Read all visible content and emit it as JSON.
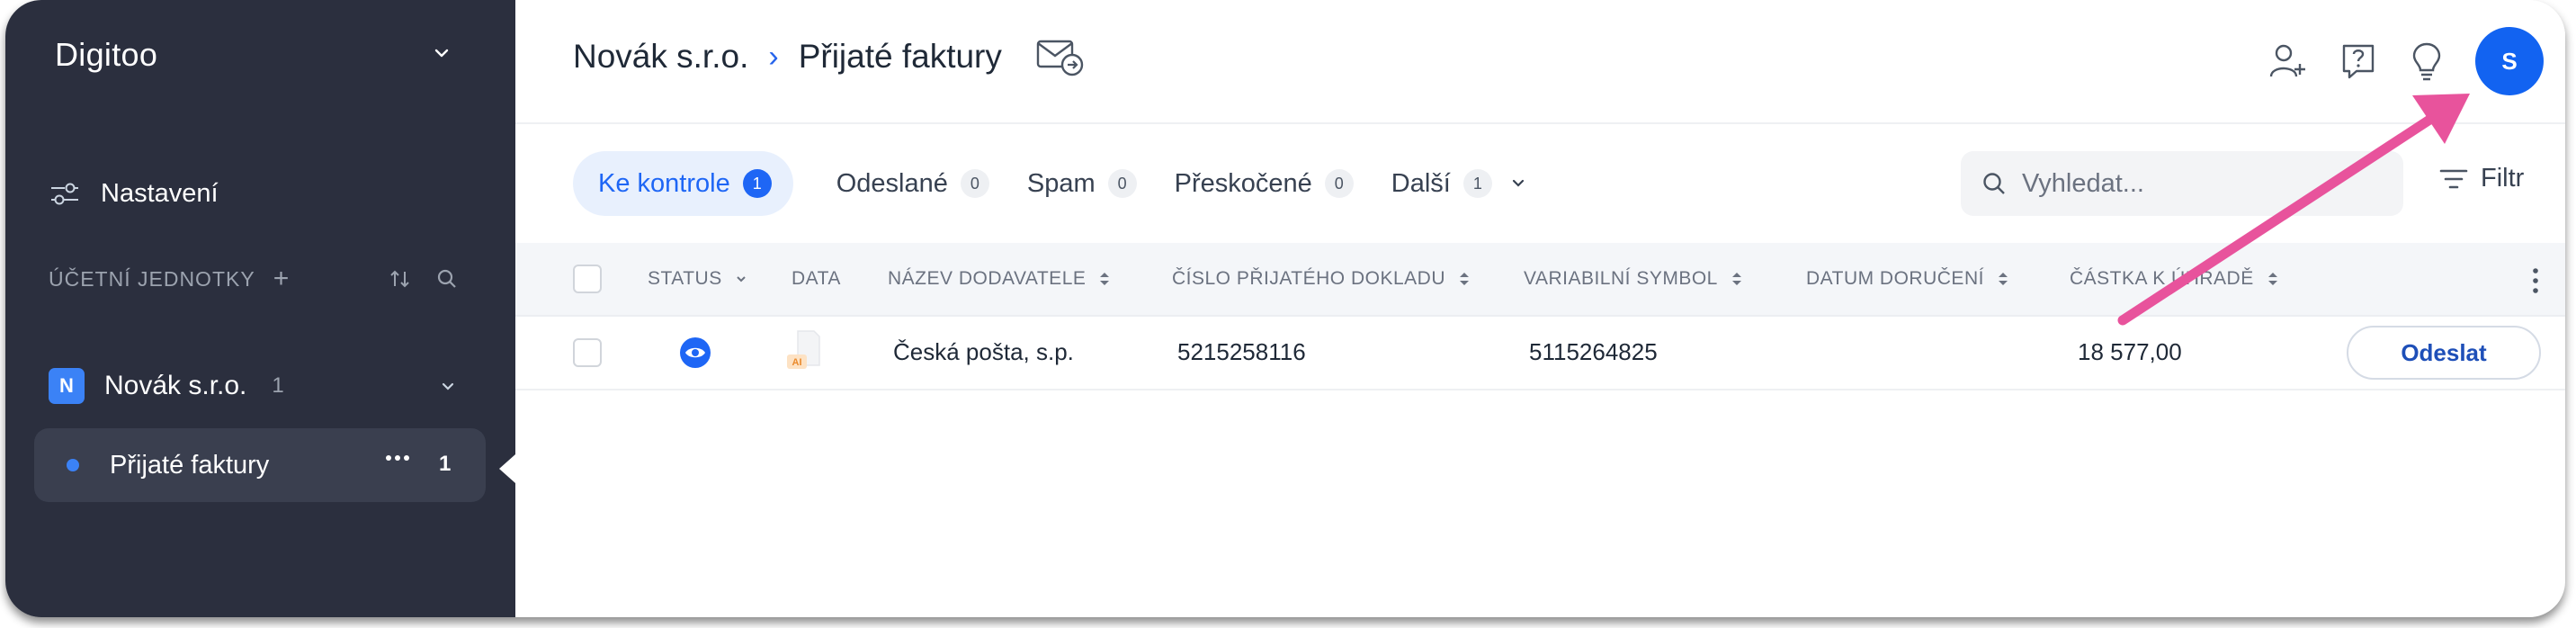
{
  "sidebar": {
    "brand": "Digitoo",
    "settings_label": "Nastavení",
    "section_title": "ÚČETNÍ JEDNOTKY",
    "company": {
      "initial": "N",
      "name": "Novák s.r.o.",
      "count": "1"
    },
    "inbox": {
      "name": "Přijaté faktury",
      "count": "1"
    }
  },
  "header": {
    "breadcrumb": [
      "Novák s.r.o.",
      "Přijaté faktury"
    ],
    "avatar_initial": "S"
  },
  "tabs": [
    {
      "label": "Ke kontrole",
      "count": "1",
      "active": true
    },
    {
      "label": "Odeslané",
      "count": "0"
    },
    {
      "label": "Spam",
      "count": "0"
    },
    {
      "label": "Přeskočené",
      "count": "0"
    },
    {
      "label": "Další",
      "count": "1"
    }
  ],
  "search": {
    "placeholder": "Vyhledat..."
  },
  "filter_label": "Filtr",
  "table": {
    "columns": [
      "STATUS",
      "DATA",
      "NÁZEV DODAVATELE",
      "ČÍSLO PŘIJATÉHO DOKLADU",
      "VARIABILNÍ SYMBOL",
      "DATUM DORUČENÍ",
      "ČÁSTKA K ÚHRADĚ"
    ],
    "rows": [
      {
        "supplier": "Česká pošta, s.p.",
        "doc_number": "5215258116",
        "var_symbol": "5115264825",
        "delivery_date": "",
        "amount": "18 577,00",
        "ai_badge": "AI",
        "action": "Odeslat"
      }
    ]
  },
  "colors": {
    "sidebar_bg": "#2b2f3e",
    "accent": "#1e66f5",
    "annotation_arrow": "#e8539c"
  }
}
